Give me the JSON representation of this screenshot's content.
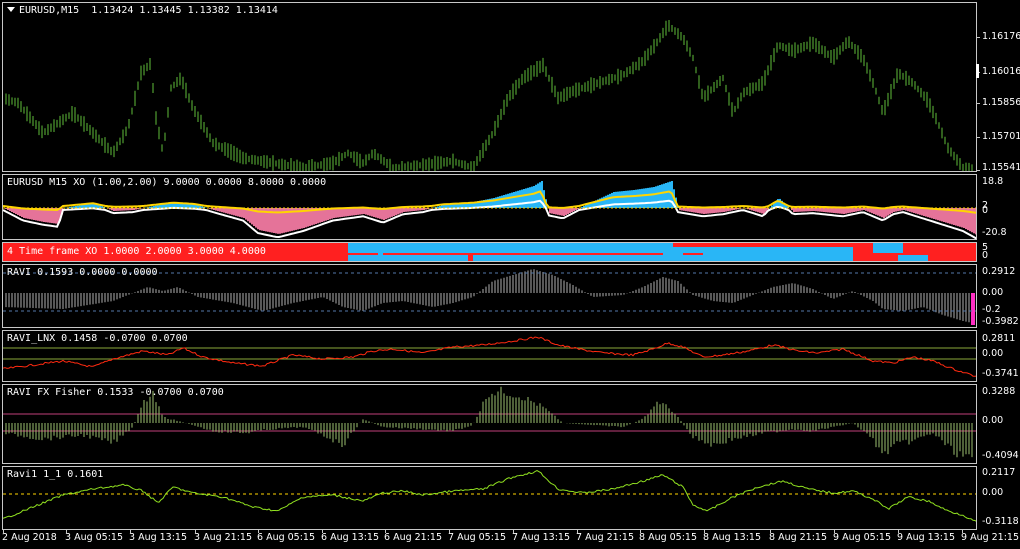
{
  "main": {
    "symbol": "EURUSD,M15",
    "ohlc": "1.13424 1.13445 1.13382 1.13414",
    "scale": [
      "1.16176",
      "1.16016",
      "1.15856",
      "1.15701",
      "1.15541"
    ]
  },
  "xo": {
    "label": "EURUSD M15 XO (1.00,2.00) 9.0000 0.0000 8.0000 0.0000",
    "scale": [
      "18.8",
      "2",
      "0",
      "-20.8"
    ],
    "colors": {
      "up": "#29b6f6",
      "down": "#e57399",
      "line": "#ffd500",
      "line2": "#ffffff"
    }
  },
  "tf": {
    "label": "4 Time frame XO 1.0000 2.0000 3.0000 4.0000",
    "scale": [
      "5",
      "0"
    ],
    "colors": {
      "bull": "#29b6f6",
      "bear": "#ff2020"
    }
  },
  "ravi": {
    "label": "RAVI 0.1593 0.0000 0.0000",
    "scale": [
      "0.2912",
      "0.00",
      "-0.2",
      "-0.3982"
    ]
  },
  "ravi_lnx": {
    "label": "RAVI_LNX 0.1458 -0.0700 0.0700",
    "scale": [
      "0.2811",
      "0.00",
      "-0.3741"
    ]
  },
  "ravi_fisher": {
    "label": "RAVI FX Fisher 0.1533 -0.0700 0.0700",
    "scale": [
      "0.3288",
      "0.00",
      "-0.4094"
    ]
  },
  "ravi1": {
    "label": "Ravi1 1_1 0.1601",
    "scale": [
      "0.2117",
      "0.00",
      "-0.3118"
    ]
  },
  "xaxis": [
    "2 Aug 2018",
    "3 Aug 05:15",
    "3 Aug 13:15",
    "3 Aug 21:15",
    "6 Aug 05:15",
    "6 Aug 13:15",
    "6 Aug 21:15",
    "7 Aug 05:15",
    "7 Aug 13:15",
    "7 Aug 21:15",
    "8 Aug 05:15",
    "8 Aug 13:15",
    "8 Aug 21:15",
    "9 Aug 05:15",
    "9 Aug 13:15",
    "9 Aug 21:15"
  ]
}
